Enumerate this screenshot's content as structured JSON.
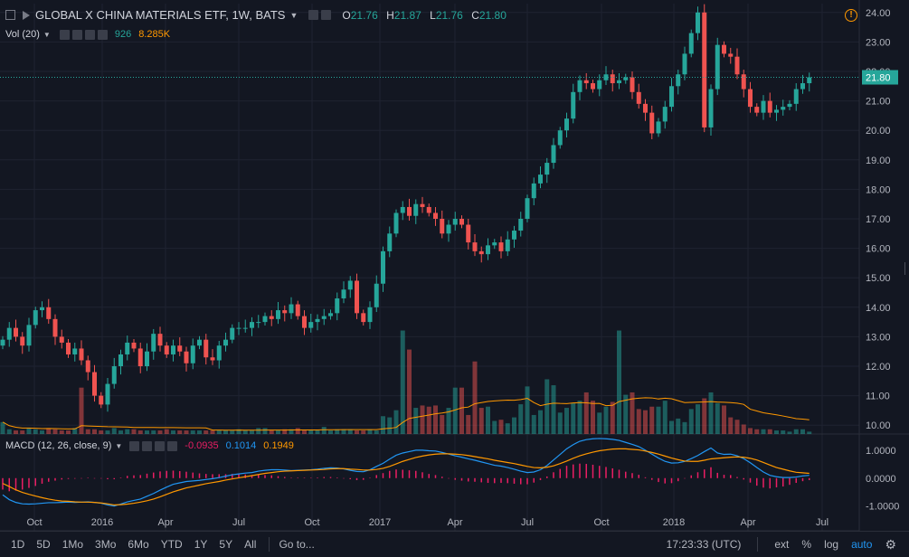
{
  "header": {
    "title": "GLOBAL X CHINA MATERIALS ETF, 1W, BATS",
    "open_label": "O",
    "open": "21.76",
    "high_label": "H",
    "high": "21.87",
    "low_label": "L",
    "low": "21.76",
    "close_label": "C",
    "close": "21.80"
  },
  "volume_legend": {
    "label": "Vol (20)",
    "value": "926",
    "ma_value": "8.285K"
  },
  "macd_legend": {
    "label": "MACD (12, 26, close, 9)",
    "hist": "-0.0935",
    "macd": "0.1014",
    "signal": "0.1949"
  },
  "colors": {
    "background": "#131722",
    "up": "#26a69a",
    "down": "#ef5350",
    "macd_line": "#2196f3",
    "signal_line": "#ff9800",
    "hist": "#e91e63",
    "price_tag": "#26a69a"
  },
  "chart_data": [
    {
      "type": "candlestick",
      "title": "GLOBAL X CHINA MATERIALS ETF, 1W, BATS",
      "yticks": [
        "10.00",
        "11.00",
        "12.00",
        "13.00",
        "14.00",
        "15.00",
        "16.00",
        "17.00",
        "18.00",
        "19.00",
        "20.00",
        "21.00",
        "22.00",
        "23.00",
        "24.00"
      ],
      "ylim": [
        9.7,
        24.3
      ],
      "xticks": [
        "Oct",
        "2016",
        "Apr",
        "Jul",
        "Oct",
        "2017",
        "Apr",
        "Jul",
        "Oct",
        "2018",
        "Apr",
        "Jul"
      ],
      "last_price": "21.80",
      "close": [
        12.9,
        13.3,
        13.0,
        12.7,
        13.4,
        13.9,
        14.0,
        13.6,
        13.0,
        12.8,
        12.4,
        12.6,
        12.2,
        11.8,
        11.0,
        10.7,
        11.4,
        12.0,
        12.4,
        12.8,
        12.6,
        12.0,
        12.5,
        13.1,
        12.7,
        12.4,
        12.7,
        12.5,
        12.1,
        12.7,
        12.9,
        12.3,
        12.2,
        12.7,
        12.9,
        13.3,
        13.3,
        13.3,
        13.5,
        13.5,
        13.7,
        13.6,
        13.9,
        13.8,
        14.1,
        13.7,
        13.3,
        13.5,
        13.6,
        13.7,
        13.8,
        14.3,
        14.6,
        14.9,
        13.8,
        13.5,
        14.0,
        14.8,
        15.9,
        16.5,
        17.2,
        17.4,
        17.1,
        17.5,
        17.4,
        17.2,
        17.0,
        16.5,
        16.8,
        17.0,
        16.8,
        16.2,
        15.9,
        15.8,
        16.1,
        16.2,
        15.9,
        16.3,
        16.6,
        17.0,
        17.7,
        18.2,
        18.5,
        18.9,
        19.5,
        20.0,
        20.4,
        21.3,
        21.7,
        21.6,
        21.4,
        21.7,
        21.9,
        21.6,
        21.7,
        21.8,
        21.3,
        20.9,
        20.6,
        19.9,
        20.3,
        20.8,
        21.5,
        21.9,
        22.6,
        23.3,
        24.0,
        20.1,
        21.4,
        22.9,
        22.6,
        22.5,
        21.9,
        21.4,
        20.8,
        20.6,
        21.0,
        20.6,
        20.7,
        20.8,
        20.9,
        21.4,
        21.6,
        21.8
      ],
      "volume": [
        1.0,
        0.4,
        0.3,
        0.3,
        0.5,
        0.4,
        0.3,
        0.5,
        0.4,
        0.3,
        0.3,
        0.5,
        3.9,
        0.4,
        0.4,
        0.3,
        0.3,
        0.5,
        0.3,
        0.4,
        0.4,
        0.3,
        0.3,
        0.3,
        0.3,
        0.4,
        0.3,
        0.3,
        0.3,
        0.3,
        0.3,
        0.3,
        0.3,
        0.3,
        0.3,
        0.3,
        0.4,
        0.3,
        0.3,
        0.5,
        0.5,
        0.3,
        0.3,
        0.4,
        0.4,
        0.5,
        0.3,
        0.3,
        0.3,
        0.6,
        0.3,
        0.4,
        0.4,
        0.4,
        0.3,
        0.3,
        0.4,
        0.3,
        1.5,
        1.4,
        2.0,
        8.7,
        7.1,
        2.2,
        2.4,
        2.3,
        2.4,
        1.6,
        2.2,
        3.9,
        3.9,
        1.6,
        6.1,
        2.2,
        2.3,
        1.1,
        1.2,
        0.9,
        1.4,
        2.5,
        4.0,
        1.6,
        2.0,
        4.6,
        4.1,
        1.8,
        2.2,
        2.6,
        2.8,
        3.5,
        2.8,
        1.8,
        2.3,
        2.7,
        8.7,
        3.3,
        3.5,
        2.1,
        2.0,
        2.3,
        2.3,
        2.8,
        1.1,
        1.3,
        1.0,
        2.1,
        2.5,
        3.0,
        3.5,
        2.6,
        2.4,
        1.4,
        1.2,
        0.8,
        0.5,
        0.4,
        0.4,
        0.4,
        0.3,
        0.3,
        0.2,
        0.4,
        0.4,
        0.2
      ],
      "macd_yticks": [
        "1.0000",
        "0.0000",
        "-1.0000"
      ],
      "macd_ylim": [
        -1.4,
        1.45
      ],
      "macd": [
        -0.6,
        -0.77,
        -0.87,
        -0.92,
        -0.93,
        -0.92,
        -0.9,
        -0.88,
        -0.88,
        -0.87,
        -0.86,
        -0.87,
        -0.86,
        -0.85,
        -0.87,
        -0.9,
        -0.96,
        -1.0,
        -0.93,
        -0.85,
        -0.8,
        -0.75,
        -0.65,
        -0.55,
        -0.43,
        -0.32,
        -0.22,
        -0.17,
        -0.12,
        -0.1,
        -0.08,
        -0.05,
        -0.02,
        0.02,
        0.07,
        0.12,
        0.15,
        0.18,
        0.2,
        0.25,
        0.28,
        0.3,
        0.3,
        0.29,
        0.27,
        0.28,
        0.29,
        0.3,
        0.32,
        0.35,
        0.37,
        0.36,
        0.33,
        0.28,
        0.24,
        0.23,
        0.3,
        0.42,
        0.53,
        0.68,
        0.82,
        0.9,
        0.95,
        1.0,
        1.0,
        0.98,
        0.97,
        0.92,
        0.86,
        0.8,
        0.75,
        0.69,
        0.64,
        0.58,
        0.52,
        0.46,
        0.43,
        0.38,
        0.32,
        0.25,
        0.2,
        0.22,
        0.3,
        0.45,
        0.65,
        0.85,
        1.05,
        1.2,
        1.32,
        1.38,
        1.41,
        1.42,
        1.41,
        1.39,
        1.35,
        1.28,
        1.21,
        1.13,
        1.0,
        0.86,
        0.72,
        0.6,
        0.54,
        0.55,
        0.6,
        0.7,
        0.81,
        0.95,
        1.08,
        0.9,
        0.85,
        0.86,
        0.8,
        0.7,
        0.55,
        0.38,
        0.22,
        0.1,
        0.05,
        0.02,
        0.02,
        0.04,
        0.08,
        0.1
      ],
      "signal": [
        -0.19,
        -0.3,
        -0.42,
        -0.51,
        -0.58,
        -0.64,
        -0.7,
        -0.75,
        -0.79,
        -0.82,
        -0.83,
        -0.85,
        -0.86,
        -0.86,
        -0.87,
        -0.89,
        -0.92,
        -0.96,
        -0.95,
        -0.93,
        -0.9,
        -0.86,
        -0.81,
        -0.75,
        -0.67,
        -0.58,
        -0.49,
        -0.42,
        -0.35,
        -0.3,
        -0.25,
        -0.2,
        -0.16,
        -0.12,
        -0.07,
        -0.03,
        0.01,
        0.05,
        0.09,
        0.13,
        0.17,
        0.2,
        0.23,
        0.25,
        0.26,
        0.27,
        0.28,
        0.29,
        0.3,
        0.31,
        0.33,
        0.34,
        0.34,
        0.32,
        0.31,
        0.29,
        0.29,
        0.31,
        0.35,
        0.42,
        0.51,
        0.6,
        0.67,
        0.74,
        0.79,
        0.83,
        0.86,
        0.87,
        0.87,
        0.86,
        0.84,
        0.81,
        0.77,
        0.73,
        0.69,
        0.64,
        0.6,
        0.56,
        0.52,
        0.47,
        0.42,
        0.38,
        0.37,
        0.39,
        0.44,
        0.52,
        0.61,
        0.71,
        0.8,
        0.87,
        0.93,
        0.98,
        1.01,
        1.04,
        1.05,
        1.05,
        1.03,
        1.01,
        0.97,
        0.92,
        0.86,
        0.79,
        0.72,
        0.66,
        0.61,
        0.6,
        0.6,
        0.64,
        0.69,
        0.71,
        0.73,
        0.75,
        0.76,
        0.75,
        0.71,
        0.65,
        0.56,
        0.47,
        0.38,
        0.32,
        0.26,
        0.21,
        0.19,
        0.17
      ],
      "hist": [
        -0.41,
        -0.47,
        -0.45,
        -0.41,
        -0.35,
        -0.28,
        -0.2,
        -0.13,
        -0.09,
        -0.05,
        -0.03,
        -0.02,
        0.0,
        0.01,
        0.0,
        -0.01,
        -0.04,
        -0.04,
        0.02,
        0.08,
        0.1,
        0.11,
        0.16,
        0.2,
        0.24,
        0.26,
        0.27,
        0.25,
        0.23,
        0.2,
        0.17,
        0.15,
        0.14,
        0.14,
        0.14,
        0.15,
        0.14,
        0.13,
        0.11,
        0.12,
        0.11,
        0.1,
        0.07,
        0.04,
        0.01,
        0.01,
        0.01,
        0.01,
        0.02,
        0.04,
        0.04,
        0.02,
        -0.01,
        -0.04,
        -0.07,
        -0.06,
        0.01,
        0.11,
        0.18,
        0.26,
        0.31,
        0.3,
        0.28,
        0.26,
        0.21,
        0.15,
        0.11,
        0.05,
        -0.01,
        -0.06,
        -0.09,
        -0.12,
        -0.13,
        -0.15,
        -0.17,
        -0.18,
        -0.17,
        -0.18,
        -0.2,
        -0.22,
        -0.22,
        -0.16,
        -0.07,
        0.06,
        0.21,
        0.33,
        0.44,
        0.49,
        0.52,
        0.51,
        0.48,
        0.44,
        0.4,
        0.35,
        0.3,
        0.23,
        0.18,
        0.12,
        0.03,
        -0.06,
        -0.14,
        -0.19,
        -0.18,
        -0.11,
        -0.01,
        0.1,
        0.21,
        0.31,
        0.39,
        0.19,
        0.12,
        0.11,
        0.04,
        -0.05,
        -0.16,
        -0.27,
        -0.34,
        -0.37,
        -0.33,
        -0.3,
        -0.24,
        -0.17,
        -0.11,
        -0.07
      ],
      "grid": true
    }
  ],
  "timeframes": [
    "1D",
    "5D",
    "1Mo",
    "3Mo",
    "6Mo",
    "YTD",
    "1Y",
    "5Y",
    "All"
  ],
  "goto_label": "Go to...",
  "clock": "17:23:33 (UTC)",
  "bottom_right": {
    "ext": "ext",
    "percent": "%",
    "log": "log",
    "auto": "auto"
  }
}
